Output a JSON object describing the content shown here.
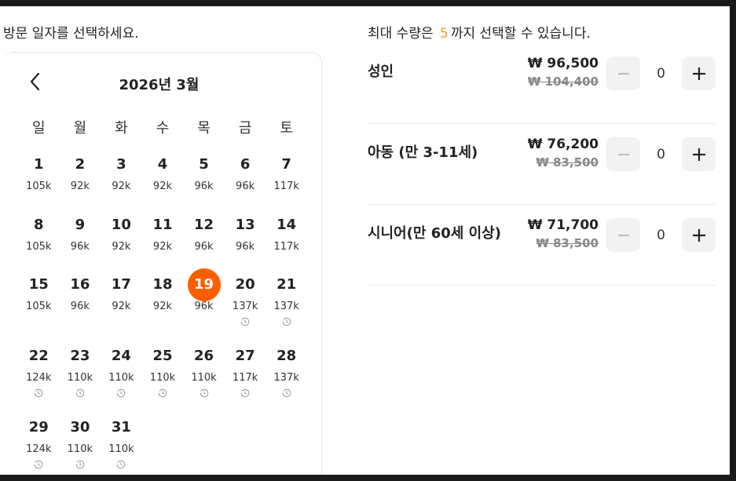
{
  "left": {
    "prompt": "방문 일자를 선택하세요."
  },
  "calendar": {
    "month_title": "2026년 3월",
    "weekdays": [
      "일",
      "월",
      "화",
      "수",
      "목",
      "금",
      "토"
    ],
    "selected_day": "19",
    "weeks": [
      [
        {
          "day": "1",
          "price": "105k",
          "icon": false
        },
        {
          "day": "2",
          "price": "92k",
          "icon": false
        },
        {
          "day": "3",
          "price": "92k",
          "icon": false
        },
        {
          "day": "4",
          "price": "92k",
          "icon": false
        },
        {
          "day": "5",
          "price": "96k",
          "icon": false
        },
        {
          "day": "6",
          "price": "96k",
          "icon": false
        },
        {
          "day": "7",
          "price": "117k",
          "icon": false
        }
      ],
      [
        {
          "day": "8",
          "price": "105k",
          "icon": false
        },
        {
          "day": "9",
          "price": "96k",
          "icon": false
        },
        {
          "day": "10",
          "price": "92k",
          "icon": false
        },
        {
          "day": "11",
          "price": "92k",
          "icon": false
        },
        {
          "day": "12",
          "price": "96k",
          "icon": false
        },
        {
          "day": "13",
          "price": "96k",
          "icon": false
        },
        {
          "day": "14",
          "price": "117k",
          "icon": false
        }
      ],
      [
        {
          "day": "15",
          "price": "105k",
          "icon": false
        },
        {
          "day": "16",
          "price": "96k",
          "icon": false
        },
        {
          "day": "17",
          "price": "92k",
          "icon": false
        },
        {
          "day": "18",
          "price": "92k",
          "icon": false
        },
        {
          "day": "19",
          "price": "96k",
          "icon": false
        },
        {
          "day": "20",
          "price": "137k",
          "icon": true
        },
        {
          "day": "21",
          "price": "137k",
          "icon": true
        }
      ],
      [
        {
          "day": "22",
          "price": "124k",
          "icon": true
        },
        {
          "day": "23",
          "price": "110k",
          "icon": true
        },
        {
          "day": "24",
          "price": "110k",
          "icon": true
        },
        {
          "day": "25",
          "price": "110k",
          "icon": true
        },
        {
          "day": "26",
          "price": "110k",
          "icon": true
        },
        {
          "day": "27",
          "price": "117k",
          "icon": true
        },
        {
          "day": "28",
          "price": "137k",
          "icon": true
        }
      ],
      [
        {
          "day": "29",
          "price": "124k",
          "icon": true
        },
        {
          "day": "30",
          "price": "110k",
          "icon": true
        },
        {
          "day": "31",
          "price": "110k",
          "icon": true
        }
      ]
    ],
    "icon_name": "clock-icon"
  },
  "right": {
    "prompt_before": "최대 수량은",
    "max_quantity": "5",
    "prompt_after": "까지 선택할 수 있습니다.",
    "accent_color": "#f0a030",
    "tickets": [
      {
        "name": "성인",
        "price": "₩ 96,500",
        "original_price": "₩ 104,400",
        "quantity": "0"
      },
      {
        "name": "아동 (만 3-11세)",
        "price": "₩ 76,200",
        "original_price": "₩ 83,500",
        "quantity": "0"
      },
      {
        "name": "시니어(만 60세 이상)",
        "price": "₩ 71,700",
        "original_price": "₩ 83,500",
        "quantity": "0"
      }
    ]
  },
  "colors": {
    "selected_day_bg": "#ff5e00",
    "button_bg": "#f2f2f2"
  }
}
